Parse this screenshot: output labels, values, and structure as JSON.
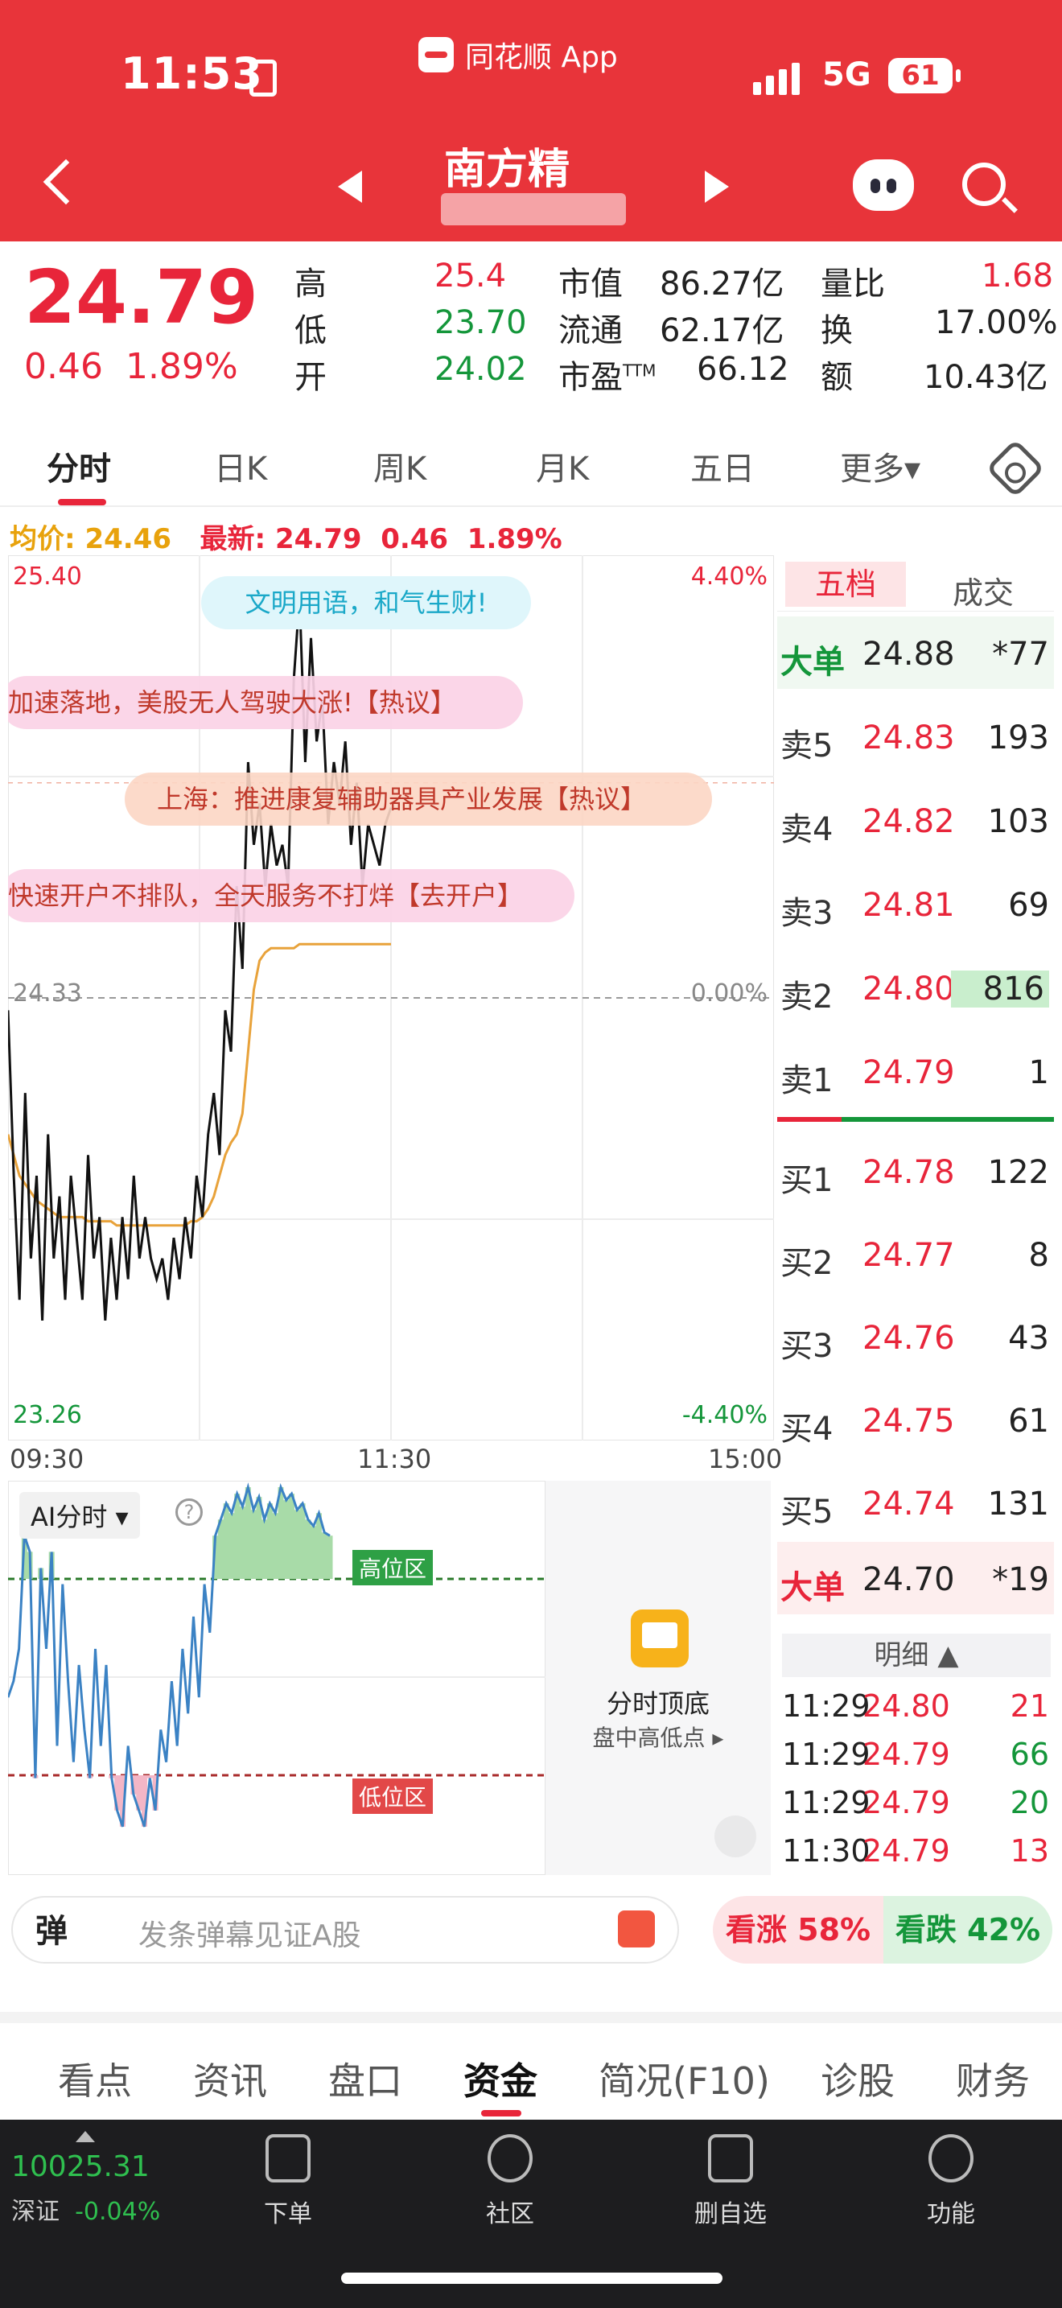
{
  "status": {
    "time": "11:53",
    "network": "5G",
    "battery": "61"
  },
  "app": {
    "name": "同花顺 App"
  },
  "stock": {
    "name": "南方精"
  },
  "quote": {
    "price": "24.79",
    "change": "0.46",
    "change_pct": "1.89%",
    "high_label": "高",
    "high": "25.4",
    "low_label": "低",
    "low": "23.70",
    "open_label": "开",
    "open": "24.02",
    "mcap_label": "市值",
    "mcap": "86.27亿",
    "float_label": "流通",
    "float": "62.17亿",
    "pe_label": "市盈",
    "pe_sup": "TTM",
    "pe": "66.12",
    "vr_label": "量比",
    "vr": "1.68",
    "turnover_label": "换",
    "turnover": "17.00%",
    "amount_label": "额",
    "amount": "10.43亿"
  },
  "tabs": [
    "分时",
    "日K",
    "周K",
    "月K",
    "五日",
    "更多▾"
  ],
  "avg_line": {
    "avg_label": "均价:",
    "avg": "24.46",
    "latest_label": "最新:",
    "latest": "24.79",
    "chg": "0.46",
    "pct": "1.89%"
  },
  "chart_data": {
    "type": "line",
    "y_max_label": "25.40",
    "y_min_label": "23.26",
    "y_ref_label": "24.33",
    "pct_max_label": "4.40%",
    "pct_min_label": "-4.40%",
    "pct_ref_label": "0.00%",
    "x_ticks": [
      "09:30",
      "11:30",
      "15:00"
    ],
    "ylim": [
      23.26,
      25.4
    ],
    "prev_close": 24.33,
    "price": [
      24.3,
      23.9,
      23.6,
      24.1,
      23.7,
      23.9,
      23.55,
      24.0,
      23.7,
      23.85,
      23.6,
      23.9,
      23.75,
      23.6,
      23.95,
      23.7,
      23.8,
      23.55,
      23.75,
      23.6,
      23.8,
      23.65,
      23.9,
      23.7,
      23.8,
      23.7,
      23.65,
      23.7,
      23.6,
      23.75,
      23.65,
      23.8,
      23.7,
      23.9,
      23.8,
      24.0,
      24.1,
      23.95,
      24.3,
      24.2,
      24.6,
      24.4,
      24.9,
      24.7,
      24.8,
      24.6,
      24.75,
      24.65,
      24.7,
      24.6,
      25.1,
      25.3,
      24.9,
      25.2,
      24.95,
      25.05,
      24.75,
      24.9,
      24.8,
      24.95,
      24.7,
      24.85,
      24.6,
      24.75,
      24.7,
      24.65,
      24.75,
      24.79
    ],
    "avg": [
      24.0,
      23.95,
      23.9,
      23.88,
      23.86,
      23.84,
      23.83,
      23.82,
      23.81,
      23.8,
      23.8,
      23.8,
      23.8,
      23.8,
      23.79,
      23.79,
      23.79,
      23.79,
      23.79,
      23.78,
      23.78,
      23.78,
      23.78,
      23.78,
      23.78,
      23.78,
      23.78,
      23.78,
      23.78,
      23.78,
      23.78,
      23.78,
      23.79,
      23.79,
      23.8,
      23.82,
      23.85,
      23.9,
      23.95,
      23.98,
      24.0,
      24.05,
      24.2,
      24.35,
      24.42,
      24.44,
      24.45,
      24.45,
      24.45,
      24.45,
      24.45,
      24.46,
      24.46,
      24.46,
      24.46,
      24.46,
      24.46,
      24.46,
      24.46,
      24.46,
      24.46,
      24.46,
      24.46,
      24.46,
      24.46,
      24.46,
      24.46,
      24.46
    ]
  },
  "overlays": {
    "b1": "文明用语，和气生财!",
    "b2": "加速落地，美股无人驾驶大涨!【热议】",
    "b3": "上海：推进康复辅助器具产业发展【热议】",
    "b4": "快速开户不排队，全天服务不打烊【去开户】"
  },
  "book": {
    "tab_five": "五档",
    "tab_trades": "成交",
    "big_sell": {
      "label": "大单",
      "price": "24.88",
      "vol": "*77"
    },
    "sells": [
      {
        "label": "卖5",
        "price": "24.83",
        "vol": "193"
      },
      {
        "label": "卖4",
        "price": "24.82",
        "vol": "103"
      },
      {
        "label": "卖3",
        "price": "24.81",
        "vol": "69"
      },
      {
        "label": "卖2",
        "price": "24.80",
        "vol": "816"
      },
      {
        "label": "卖1",
        "price": "24.79",
        "vol": "1"
      }
    ],
    "buys": [
      {
        "label": "买1",
        "price": "24.78",
        "vol": "122"
      },
      {
        "label": "买2",
        "price": "24.77",
        "vol": "8"
      },
      {
        "label": "买3",
        "price": "24.76",
        "vol": "43"
      },
      {
        "label": "买4",
        "price": "24.75",
        "vol": "61"
      },
      {
        "label": "买5",
        "price": "24.74",
        "vol": "131"
      }
    ],
    "big_buy": {
      "label": "大单",
      "price": "24.70",
      "vol": "*19"
    },
    "detail_label": "明细 ▲",
    "details": [
      {
        "time": "11:29",
        "price": "24.80",
        "vol": "21",
        "dir": "up"
      },
      {
        "time": "11:29",
        "price": "24.79",
        "vol": "66",
        "dir": "down"
      },
      {
        "time": "11:29",
        "price": "24.79",
        "vol": "20",
        "dir": "down"
      },
      {
        "time": "11:30",
        "price": "24.79",
        "vol": "13",
        "dir": "up"
      }
    ]
  },
  "ai": {
    "label": "AI分时 ▾",
    "high_zone": "高位区",
    "low_zone": "低位区",
    "card_title": "分时顶底",
    "card_sub": "盘中高低点 ▸",
    "series": [
      0.45,
      0.5,
      0.6,
      0.95,
      0.9,
      0.2,
      0.85,
      0.6,
      0.9,
      0.3,
      0.8,
      0.5,
      0.25,
      0.55,
      0.35,
      0.2,
      0.6,
      0.3,
      0.55,
      0.2,
      0.1,
      0.05,
      0.3,
      0.15,
      0.1,
      0.05,
      0.2,
      0.1,
      0.35,
      0.25,
      0.5,
      0.3,
      0.6,
      0.4,
      0.7,
      0.45,
      0.8,
      0.65,
      0.95,
      1.0,
      1.05,
      1.02,
      1.08,
      1.04,
      1.1,
      1.03,
      1.07,
      1.0,
      1.05,
      1.02,
      1.1,
      1.06,
      1.08,
      1.03,
      1.05,
      1.0,
      0.98,
      1.02,
      0.96,
      0.95
    ]
  },
  "danmu": {
    "badge": "弹",
    "placeholder": "发条弹幕见证A股"
  },
  "votes": {
    "up": "看涨 58%",
    "down": "看跌 42%"
  },
  "bottom_tabs": [
    "看点",
    "资讯",
    "盘口",
    "资金",
    "简况(F10)",
    "诊股",
    "财务"
  ],
  "footer": {
    "index_value": "10025.31",
    "index_name": "深证",
    "index_chg": "-0.04%",
    "items": [
      "下单",
      "社区",
      "删自选",
      "功能"
    ]
  }
}
